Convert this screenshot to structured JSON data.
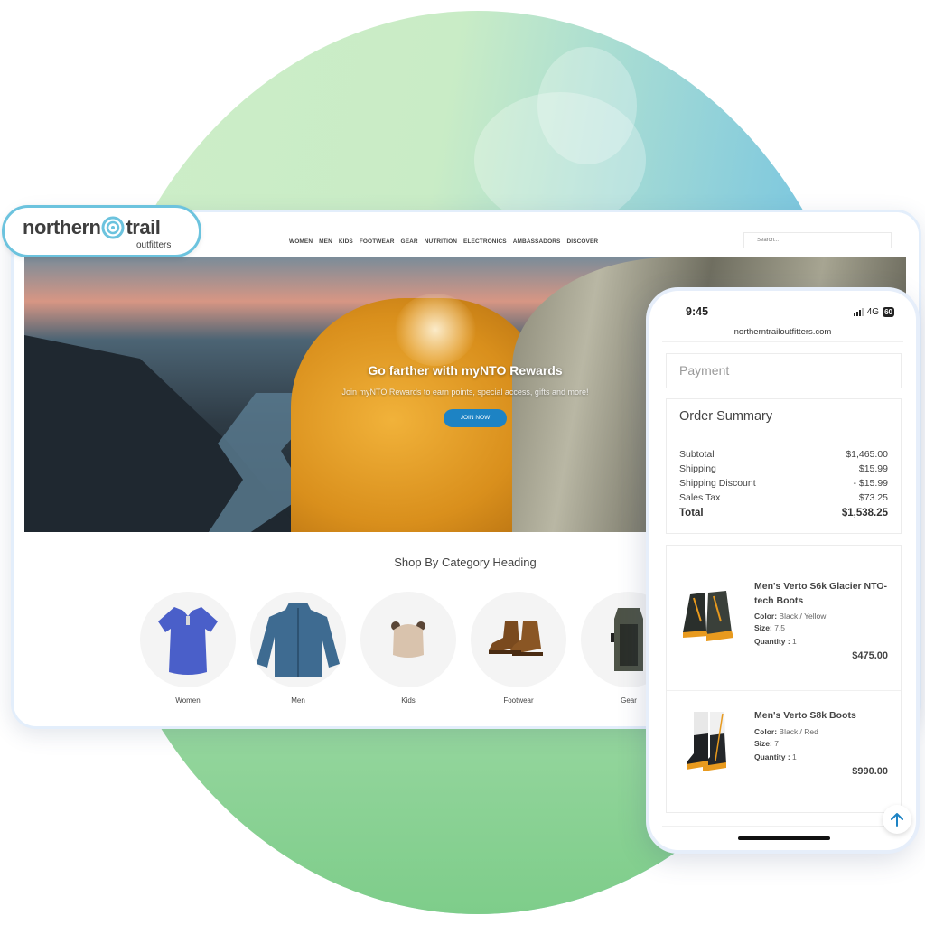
{
  "brand": {
    "logo_main_left": "northern",
    "logo_main_right": "trail",
    "logo_sub": "outfitters",
    "accent": "#6cc3de"
  },
  "tablet": {
    "nav": [
      "WOMEN",
      "MEN",
      "KIDS",
      "FOOTWEAR",
      "GEAR",
      "NUTRITION",
      "ELECTRONICS",
      "AMBASSADORS",
      "DISCOVER"
    ],
    "search_placeholder": "Search...",
    "hero": {
      "title": "Go farther with myNTO Rewards",
      "subtitle": "Join myNTO Rewards to earn points, special access, gifts and more!",
      "cta": "JOIN NOW",
      "cta_color": "#1d83c4"
    },
    "shop_heading": "Shop By Category Heading",
    "categories": [
      {
        "label": "Women",
        "icon": "t-shirt-icon"
      },
      {
        "label": "Men",
        "icon": "jacket-icon"
      },
      {
        "label": "Kids",
        "icon": "beanie-icon"
      },
      {
        "label": "Footwear",
        "icon": "boots-icon"
      },
      {
        "label": "Gear",
        "icon": "backpack-icon"
      }
    ]
  },
  "phone": {
    "time": "9:45",
    "network": "4G",
    "battery": "60",
    "url": "northerntrailoutfitters.com",
    "payment_label": "Payment",
    "summary": {
      "title": "Order Summary",
      "rows": [
        {
          "label": "Subtotal",
          "value": "$1,465.00"
        },
        {
          "label": "Shipping",
          "value": "$15.99"
        },
        {
          "label": "Shipping Discount",
          "value": "- $15.99"
        },
        {
          "label": "Sales Tax",
          "value": "$73.25"
        }
      ],
      "total_label": "Total",
      "total_value": "$1,538.25"
    },
    "items": [
      {
        "name": "Men's Verto S6k Glacier NTO-tech Boots",
        "color_label": "Color:",
        "color": "Black / Yellow",
        "size_label": "Size:",
        "size": "7.5",
        "qty_label": "Quantity :",
        "qty": "1",
        "price": "$475.00"
      },
      {
        "name": "Men's Verto S8k Boots",
        "color_label": "Color:",
        "color": "Black / Red",
        "size_label": "Size:",
        "size": "7",
        "qty_label": "Quantity :",
        "qty": "1",
        "price": "$990.00"
      }
    ],
    "scroll_top_icon": "arrow-up-icon"
  }
}
